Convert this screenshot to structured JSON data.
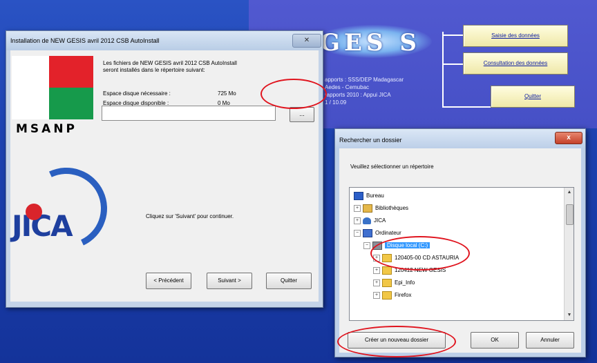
{
  "app": {
    "logo_text": "GES S",
    "info_lines": [
      "apports : SSS/DEP Madagascar",
      "Aedes - Cemubac",
      "rapports 2010 : Appui JICA",
      "1 / 10.09"
    ],
    "buttons": {
      "saisie": "Saisie des données",
      "consultation": "Consultation des données",
      "quitter": "Quitter"
    }
  },
  "installer": {
    "title": "Installation de NEW GESIS avril 2012 CSB AutoInstall",
    "close_glyph": "✕",
    "intro_line1": "Les fichiers de NEW GESIS avril 2012 CSB AutoInstall",
    "intro_line2": "seront installés dans le répertoire suivant:",
    "path_value": "",
    "browse_label": "...",
    "space_required_label": "Espace disque nécessaire :",
    "space_required_value": "725 Mo",
    "space_available_label": "Espace disque disponible :",
    "space_available_value": "0 Mo",
    "msanp": "MSANP",
    "jica": "JICA",
    "hint": "Cliquez sur 'Suivant' pour continuer.",
    "prev_label": "< Précédent",
    "next_label": "Suivant >",
    "quit_label": "Quitter"
  },
  "folder_dialog": {
    "title": "Rechercher un dossier",
    "close_glyph": "x",
    "prompt": "Veuillez sélectionner un répertoire",
    "tree": [
      {
        "label": "Bureau"
      },
      {
        "label": "Bibliothèques"
      },
      {
        "label": "JICA"
      },
      {
        "label": "Ordinateur"
      },
      {
        "label": "Disque local (C:)"
      },
      {
        "label": "120405-00 CD ASTAURIA"
      },
      {
        "label": "120412 NEW GESIS"
      },
      {
        "label": "Epi_Info"
      },
      {
        "label": "Firefox"
      }
    ],
    "new_folder_label": "Créer un nouveau dossier",
    "ok_label": "OK",
    "cancel_label": "Annuler"
  },
  "colors": {
    "annotation_red": "#e0141e",
    "selection_blue": "#3399ff",
    "desktop_blue": "#1d42b0"
  }
}
